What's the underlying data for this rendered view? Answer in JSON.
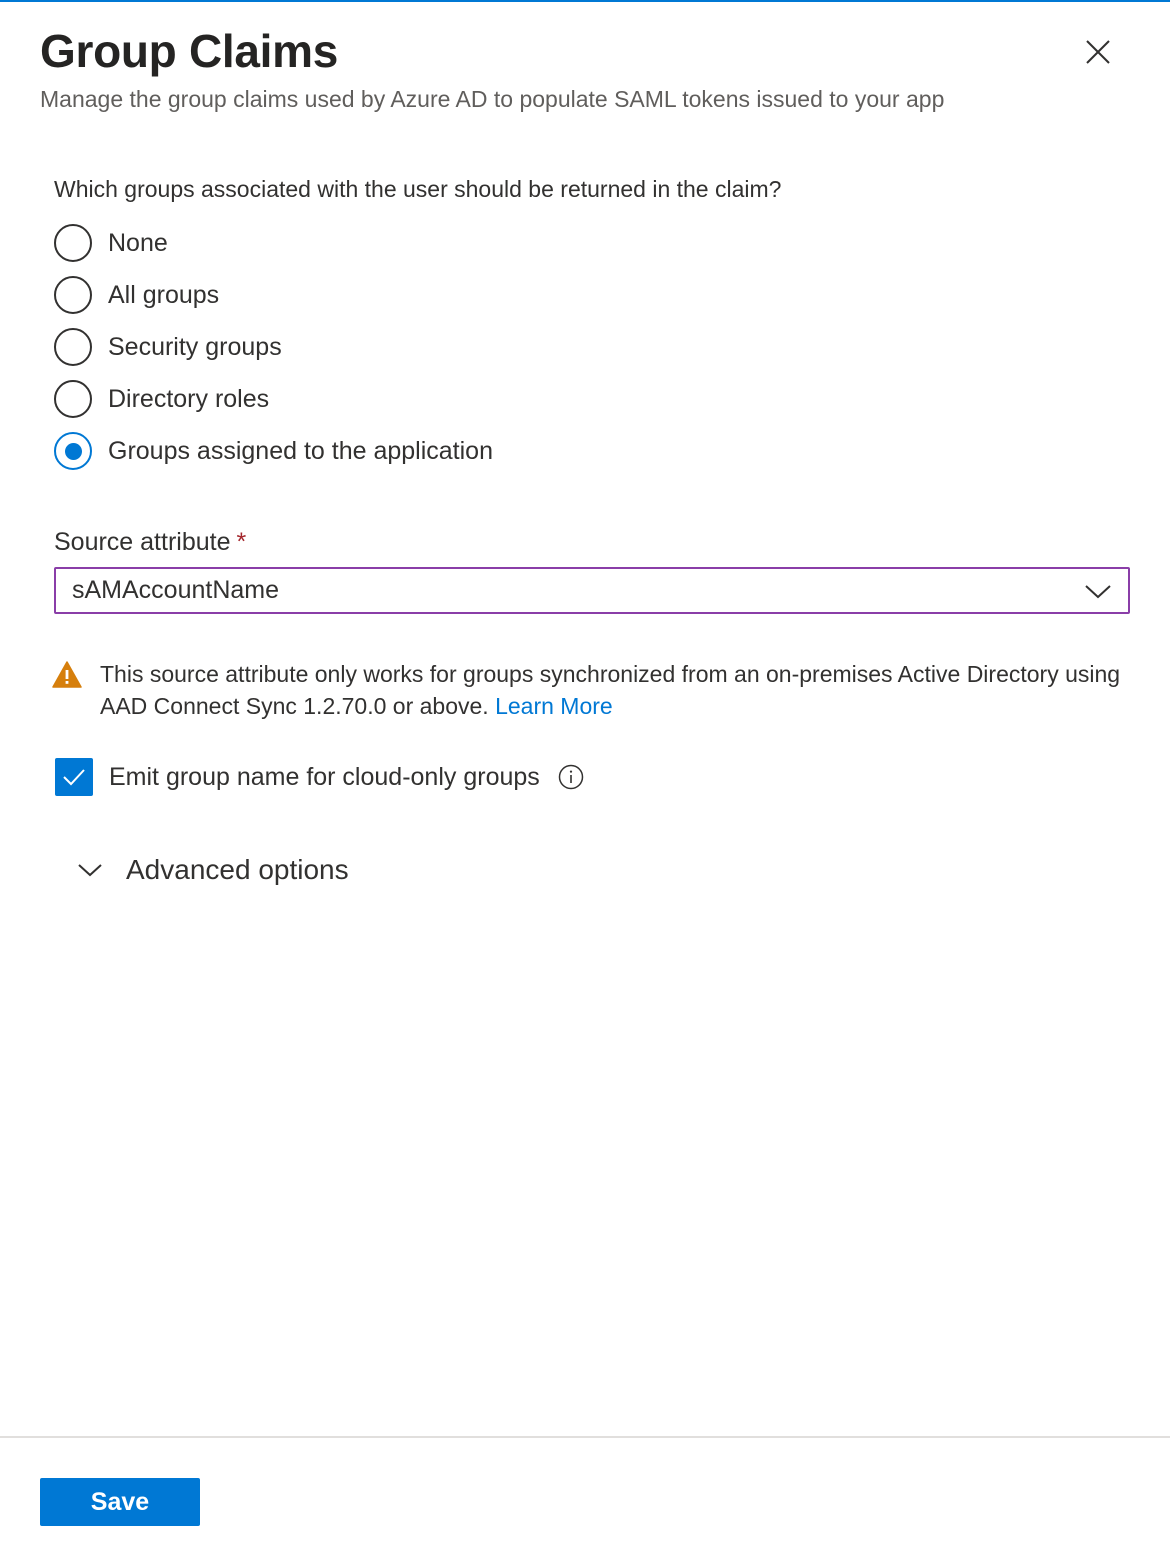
{
  "header": {
    "title": "Group Claims",
    "subtitle": "Manage the group claims used by Azure AD to populate SAML tokens issued to your app",
    "close_icon": "close-icon"
  },
  "groups_question": "Which groups associated with the user should be returned in the claim?",
  "radio_options": [
    {
      "label": "None",
      "selected": false
    },
    {
      "label": "All groups",
      "selected": false
    },
    {
      "label": "Security groups",
      "selected": false
    },
    {
      "label": "Directory roles",
      "selected": false
    },
    {
      "label": "Groups assigned to the application",
      "selected": true
    }
  ],
  "source_attribute": {
    "label": "Source attribute",
    "required_marker": "*",
    "value": "sAMAccountName"
  },
  "warning": {
    "text": "This source attribute only works for groups synchronized from an on-premises Active Directory using AAD Connect Sync 1.2.70.0 or above.",
    "link_text": "Learn More"
  },
  "emit_cloud_only": {
    "label": "Emit group name for cloud-only groups",
    "checked": true
  },
  "advanced_options": {
    "label": "Advanced options"
  },
  "footer": {
    "save_label": "Save"
  },
  "colors": {
    "accent": "#0078d4",
    "dropdown_border": "#8a3ea8",
    "warning": "#d67f0c",
    "required": "#a4262c"
  }
}
